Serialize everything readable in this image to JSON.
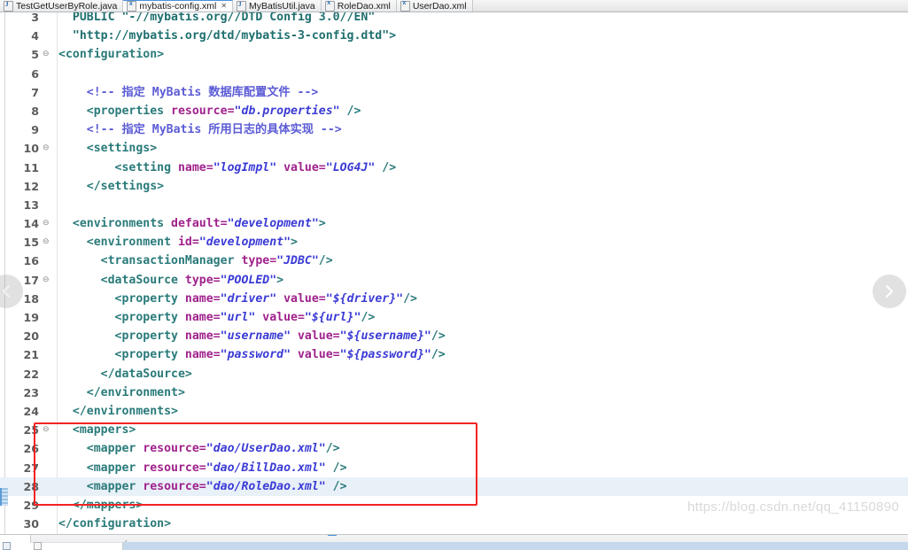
{
  "window": {
    "app": "Eclipse IDE XML Editor"
  },
  "tabs": [
    {
      "label": "TestGetUserByRole.java",
      "icon": "java-file-icon",
      "active": false,
      "closeable": false
    },
    {
      "label": "mybatis-config.xml",
      "icon": "xml-file-icon",
      "active": true,
      "closeable": true,
      "close_glyph": "✕"
    },
    {
      "label": "MyBatisUtil.java",
      "icon": "java-file-icon",
      "active": false,
      "closeable": false
    },
    {
      "label": "RoleDao.xml",
      "icon": "xml-file-icon",
      "active": false,
      "closeable": false
    },
    {
      "label": "UserDao.xml",
      "icon": "xml-file-icon",
      "active": false,
      "closeable": false
    }
  ],
  "editor": {
    "fold_glyph": "⊖",
    "lines": [
      {
        "num": "3",
        "fold": false,
        "highlight": false,
        "segments": [
          {
            "t": "  PUBLIC ",
            "c": "doct"
          },
          {
            "t": "\"-//mybatis.org//DTD Config 3.0//EN\"",
            "c": "doct"
          }
        ]
      },
      {
        "num": "4",
        "fold": false,
        "highlight": false,
        "segments": [
          {
            "t": "  \"http://mybatis.org/dtd/mybatis-3-config.dtd\">",
            "c": "doct"
          }
        ]
      },
      {
        "num": "5",
        "fold": true,
        "highlight": false,
        "segments": [
          {
            "t": "<configuration>",
            "c": "tg"
          }
        ]
      },
      {
        "num": "6",
        "fold": false,
        "highlight": false,
        "segments": []
      },
      {
        "num": "7",
        "fold": false,
        "highlight": false,
        "segments": [
          {
            "t": "    <!-- 指定 MyBatis 数据库配置文件 -->",
            "c": "cm"
          }
        ]
      },
      {
        "num": "8",
        "fold": false,
        "highlight": false,
        "segments": [
          {
            "t": "    <properties ",
            "c": "tg"
          },
          {
            "t": "resource=",
            "c": "at"
          },
          {
            "t": "\"db.properties\"",
            "c": "val"
          },
          {
            "t": " />",
            "c": "tg"
          }
        ]
      },
      {
        "num": "9",
        "fold": false,
        "highlight": false,
        "segments": [
          {
            "t": "    <!-- 指定 MyBatis 所用日志的具体实现 -->",
            "c": "cm"
          }
        ]
      },
      {
        "num": "10",
        "fold": true,
        "highlight": false,
        "segments": [
          {
            "t": "    <settings>",
            "c": "tg"
          }
        ]
      },
      {
        "num": "11",
        "fold": false,
        "highlight": false,
        "segments": [
          {
            "t": "        <setting ",
            "c": "tg"
          },
          {
            "t": "name=",
            "c": "at"
          },
          {
            "t": "\"logImpl\"",
            "c": "val"
          },
          {
            "t": " ",
            "c": "plain"
          },
          {
            "t": "value=",
            "c": "at"
          },
          {
            "t": "\"LOG4J\"",
            "c": "val"
          },
          {
            "t": " />",
            "c": "tg"
          }
        ]
      },
      {
        "num": "12",
        "fold": false,
        "highlight": false,
        "segments": [
          {
            "t": "    </settings>",
            "c": "tg"
          }
        ]
      },
      {
        "num": "13",
        "fold": false,
        "highlight": false,
        "segments": []
      },
      {
        "num": "14",
        "fold": true,
        "highlight": false,
        "segments": [
          {
            "t": "  <environments ",
            "c": "tg"
          },
          {
            "t": "default=",
            "c": "at"
          },
          {
            "t": "\"development\"",
            "c": "val"
          },
          {
            "t": ">",
            "c": "tg"
          }
        ]
      },
      {
        "num": "15",
        "fold": true,
        "highlight": false,
        "segments": [
          {
            "t": "    <environment ",
            "c": "tg"
          },
          {
            "t": "id=",
            "c": "at"
          },
          {
            "t": "\"development\"",
            "c": "val"
          },
          {
            "t": ">",
            "c": "tg"
          }
        ]
      },
      {
        "num": "16",
        "fold": false,
        "highlight": false,
        "segments": [
          {
            "t": "      <transactionManager ",
            "c": "tg"
          },
          {
            "t": "type=",
            "c": "at"
          },
          {
            "t": "\"JDBC\"",
            "c": "val"
          },
          {
            "t": "/>",
            "c": "tg"
          }
        ]
      },
      {
        "num": "17",
        "fold": true,
        "highlight": false,
        "segments": [
          {
            "t": "      <dataSource ",
            "c": "tg"
          },
          {
            "t": "type=",
            "c": "at"
          },
          {
            "t": "\"POOLED\"",
            "c": "val"
          },
          {
            "t": ">",
            "c": "tg"
          }
        ]
      },
      {
        "num": "18",
        "fold": false,
        "highlight": false,
        "segments": [
          {
            "t": "        <property ",
            "c": "tg"
          },
          {
            "t": "name=",
            "c": "at"
          },
          {
            "t": "\"driver\"",
            "c": "val"
          },
          {
            "t": " ",
            "c": "plain"
          },
          {
            "t": "value=",
            "c": "at"
          },
          {
            "t": "\"${driver}\"",
            "c": "val"
          },
          {
            "t": "/>",
            "c": "tg"
          }
        ]
      },
      {
        "num": "19",
        "fold": false,
        "highlight": false,
        "segments": [
          {
            "t": "        <property ",
            "c": "tg"
          },
          {
            "t": "name=",
            "c": "at"
          },
          {
            "t": "\"url\"",
            "c": "val"
          },
          {
            "t": " ",
            "c": "plain"
          },
          {
            "t": "value=",
            "c": "at"
          },
          {
            "t": "\"${url}\"",
            "c": "val"
          },
          {
            "t": "/>",
            "c": "tg"
          }
        ]
      },
      {
        "num": "20",
        "fold": false,
        "highlight": false,
        "segments": [
          {
            "t": "        <property ",
            "c": "tg"
          },
          {
            "t": "name=",
            "c": "at"
          },
          {
            "t": "\"username\"",
            "c": "val"
          },
          {
            "t": " ",
            "c": "plain"
          },
          {
            "t": "value=",
            "c": "at"
          },
          {
            "t": "\"${username}\"",
            "c": "val"
          },
          {
            "t": "/>",
            "c": "tg"
          }
        ]
      },
      {
        "num": "21",
        "fold": false,
        "highlight": false,
        "segments": [
          {
            "t": "        <property ",
            "c": "tg"
          },
          {
            "t": "name=",
            "c": "at"
          },
          {
            "t": "\"password\"",
            "c": "val"
          },
          {
            "t": " ",
            "c": "plain"
          },
          {
            "t": "value=",
            "c": "at"
          },
          {
            "t": "\"${password}\"",
            "c": "val"
          },
          {
            "t": "/>",
            "c": "tg"
          }
        ]
      },
      {
        "num": "22",
        "fold": false,
        "highlight": false,
        "segments": [
          {
            "t": "      </dataSource>",
            "c": "tg"
          }
        ]
      },
      {
        "num": "23",
        "fold": false,
        "highlight": false,
        "segments": [
          {
            "t": "    </environment>",
            "c": "tg"
          }
        ]
      },
      {
        "num": "24",
        "fold": false,
        "highlight": false,
        "segments": [
          {
            "t": "  </environments>",
            "c": "tg"
          }
        ]
      },
      {
        "num": "25",
        "fold": true,
        "highlight": false,
        "segments": [
          {
            "t": "  <mappers>",
            "c": "tg"
          }
        ]
      },
      {
        "num": "26",
        "fold": false,
        "highlight": false,
        "segments": [
          {
            "t": "    <mapper ",
            "c": "tg"
          },
          {
            "t": "resource=",
            "c": "at"
          },
          {
            "t": "\"dao/UserDao.xml\"",
            "c": "val"
          },
          {
            "t": "/>",
            "c": "tg"
          }
        ]
      },
      {
        "num": "27",
        "fold": false,
        "highlight": false,
        "segments": [
          {
            "t": "    <mapper ",
            "c": "tg"
          },
          {
            "t": "resource=",
            "c": "at"
          },
          {
            "t": "\"dao/BillDao.xml\"",
            "c": "val"
          },
          {
            "t": " />",
            "c": "tg"
          }
        ]
      },
      {
        "num": "28",
        "fold": false,
        "highlight": true,
        "segments": [
          {
            "t": "    <mapper ",
            "c": "tg"
          },
          {
            "t": "resource=",
            "c": "at"
          },
          {
            "t": "\"dao/RoleDao.xml\"",
            "c": "val"
          },
          {
            "t": " />",
            "c": "tg"
          }
        ]
      },
      {
        "num": "29",
        "fold": false,
        "highlight": false,
        "segments": [
          {
            "t": "  </mappers>",
            "c": "tg"
          }
        ]
      },
      {
        "num": "30",
        "fold": false,
        "highlight": false,
        "segments": [
          {
            "t": "</configuration>",
            "c": "tg"
          }
        ]
      }
    ]
  },
  "annotation": {
    "type": "red-rectangle",
    "color": "#f42222",
    "encloses_lines": [
      "25",
      "26",
      "27",
      "28",
      "29"
    ]
  },
  "nav": {
    "prev_glyph": "‹",
    "next_glyph": "›"
  },
  "watermark": {
    "text": "https://blog.csdn.net/qq_41150890"
  },
  "bottom_panel": {
    "chevron": "‹"
  },
  "colors": {
    "tag": "#2a7a7a",
    "attribute": "#a0228c",
    "value": "#3b3bd6",
    "comment": "#5c5cd6",
    "highlight_line": "#e8f0f8",
    "annotation_red": "#f42222"
  }
}
